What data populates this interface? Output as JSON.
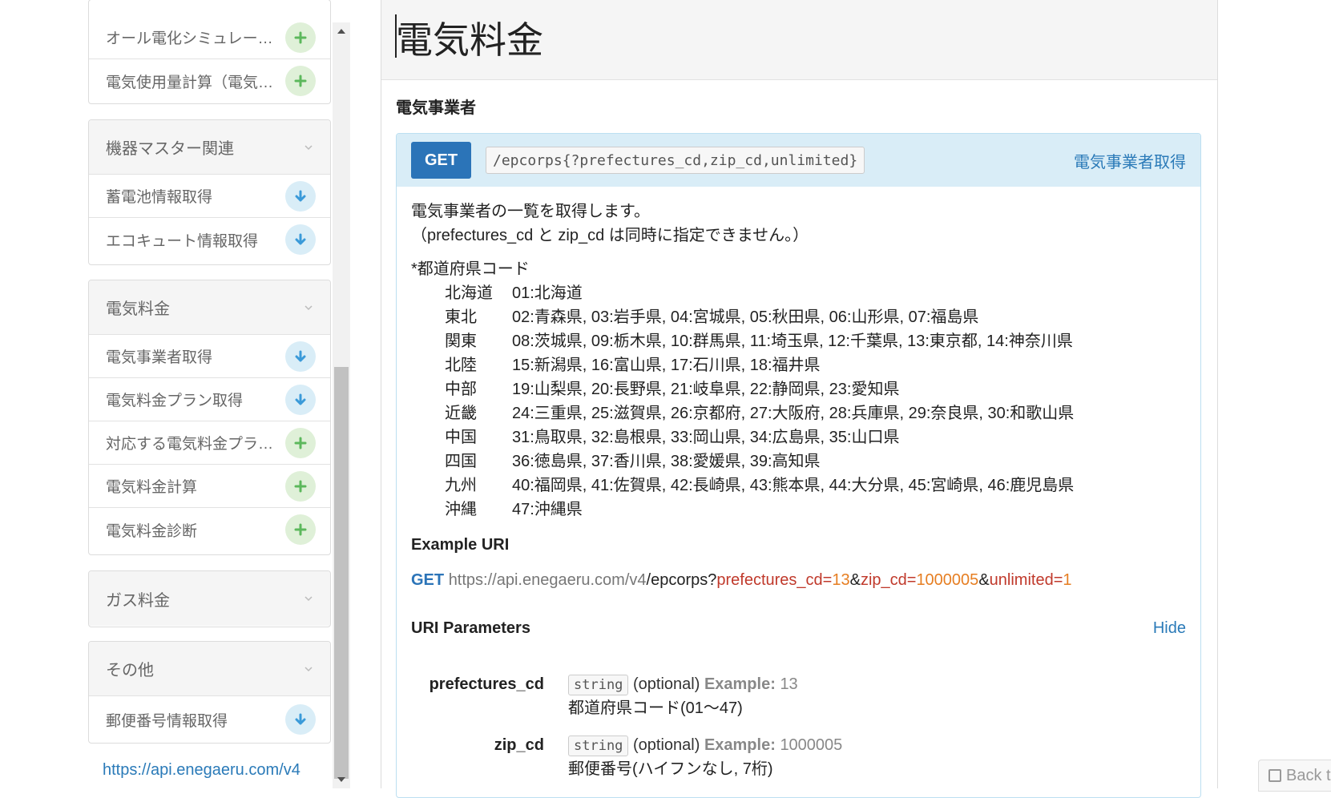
{
  "sidebar": {
    "group0": {
      "items": [
        {
          "label": "オール電化シミュレー…",
          "icon": "plus-icon"
        },
        {
          "label": "電気使用量計算（電気…",
          "icon": "plus-icon"
        }
      ]
    },
    "group1": {
      "title": "機器マスター関連",
      "items": [
        {
          "label": "蓄電池情報取得",
          "icon": "download-icon"
        },
        {
          "label": "エコキュート情報取得",
          "icon": "download-icon"
        }
      ]
    },
    "group2": {
      "title": "電気料金",
      "items": [
        {
          "label": "電気事業者取得",
          "icon": "download-icon"
        },
        {
          "label": "電気料金プラン取得",
          "icon": "download-icon"
        },
        {
          "label": "対応する電気料金プラ…",
          "icon": "plus-icon"
        },
        {
          "label": "電気料金計算",
          "icon": "plus-icon"
        },
        {
          "label": "電気料金診断",
          "icon": "plus-icon"
        }
      ]
    },
    "group3": {
      "title": "ガス料金"
    },
    "group4": {
      "title": "その他",
      "items": [
        {
          "label": "郵便番号情報取得",
          "icon": "download-icon"
        }
      ]
    },
    "base_url": "https://api.enegaeru.com/v4"
  },
  "main": {
    "title": "電気料金",
    "section_title": "電気事業者",
    "endpoint": {
      "method": "GET",
      "uri_template": "/epcorps{?prefectures_cd,zip_cd,unlimited}",
      "name": "電気事業者取得",
      "description_line1": "電気事業者の一覧を取得します。",
      "description_line2": "（prefectures_cd と zip_cd は同時に指定できません。）",
      "prefecture_title": "*都道府県コード",
      "regions": [
        {
          "name": "北海道",
          "codes": "01:北海道"
        },
        {
          "name": "東北",
          "codes": "02:青森県, 03:岩手県, 04:宮城県, 05:秋田県, 06:山形県, 07:福島県"
        },
        {
          "name": "関東",
          "codes": "08:茨城県, 09:栃木県, 10:群馬県, 11:埼玉県, 12:千葉県, 13:東京都, 14:神奈川県"
        },
        {
          "name": "北陸",
          "codes": "15:新潟県, 16:富山県, 17:石川県, 18:福井県"
        },
        {
          "name": "中部",
          "codes": "19:山梨県, 20:長野県, 21:岐阜県, 22:静岡県, 23:愛知県"
        },
        {
          "name": "近畿",
          "codes": "24:三重県, 25:滋賀県, 26:京都府, 27:大阪府, 28:兵庫県, 29:奈良県, 30:和歌山県"
        },
        {
          "name": "中国",
          "codes": "31:鳥取県, 32:島根県, 33:岡山県, 34:広島県, 35:山口県"
        },
        {
          "name": "四国",
          "codes": "36:徳島県, 37:香川県, 38:愛媛県, 39:高知県"
        },
        {
          "name": "九州",
          "codes": "40:福岡県, 41:佐賀県, 42:長崎県, 43:熊本県, 44:大分県, 45:宮崎県, 46:鹿児島県"
        },
        {
          "name": "沖縄",
          "codes": "47:沖縄県"
        }
      ],
      "example_uri_title": "Example URI",
      "example_uri": {
        "method": "GET",
        "host": "https://api.enegaeru.com/v4",
        "path": "/epcorps?",
        "p1": "prefectures_cd=",
        "v1": "13",
        "amp1": "&",
        "p2": "zip_cd=",
        "v2": "1000005",
        "amp2": "&",
        "p3": "unlimited=",
        "v3": "1"
      },
      "uri_params_title": "URI Parameters",
      "hide_label": "Hide",
      "params": [
        {
          "name": "prefectures_cd",
          "type": "string",
          "optional": "(optional)",
          "example_label": "Example:",
          "example": "13",
          "desc": "都道府県コード(01～47)"
        },
        {
          "name": "zip_cd",
          "type": "string",
          "optional": "(optional)",
          "example_label": "Example:",
          "example": "1000005",
          "desc": "郵便番号(ハイフンなし, 7桁)"
        }
      ]
    }
  },
  "back_button": {
    "label": "Back t"
  },
  "colors": {
    "accent": "#2b74b8",
    "link": "#2a7ab8",
    "plus_bg": "#dff0d8",
    "down_bg": "#d9edf7",
    "param": "#c0392b",
    "value": "#e67e22"
  }
}
